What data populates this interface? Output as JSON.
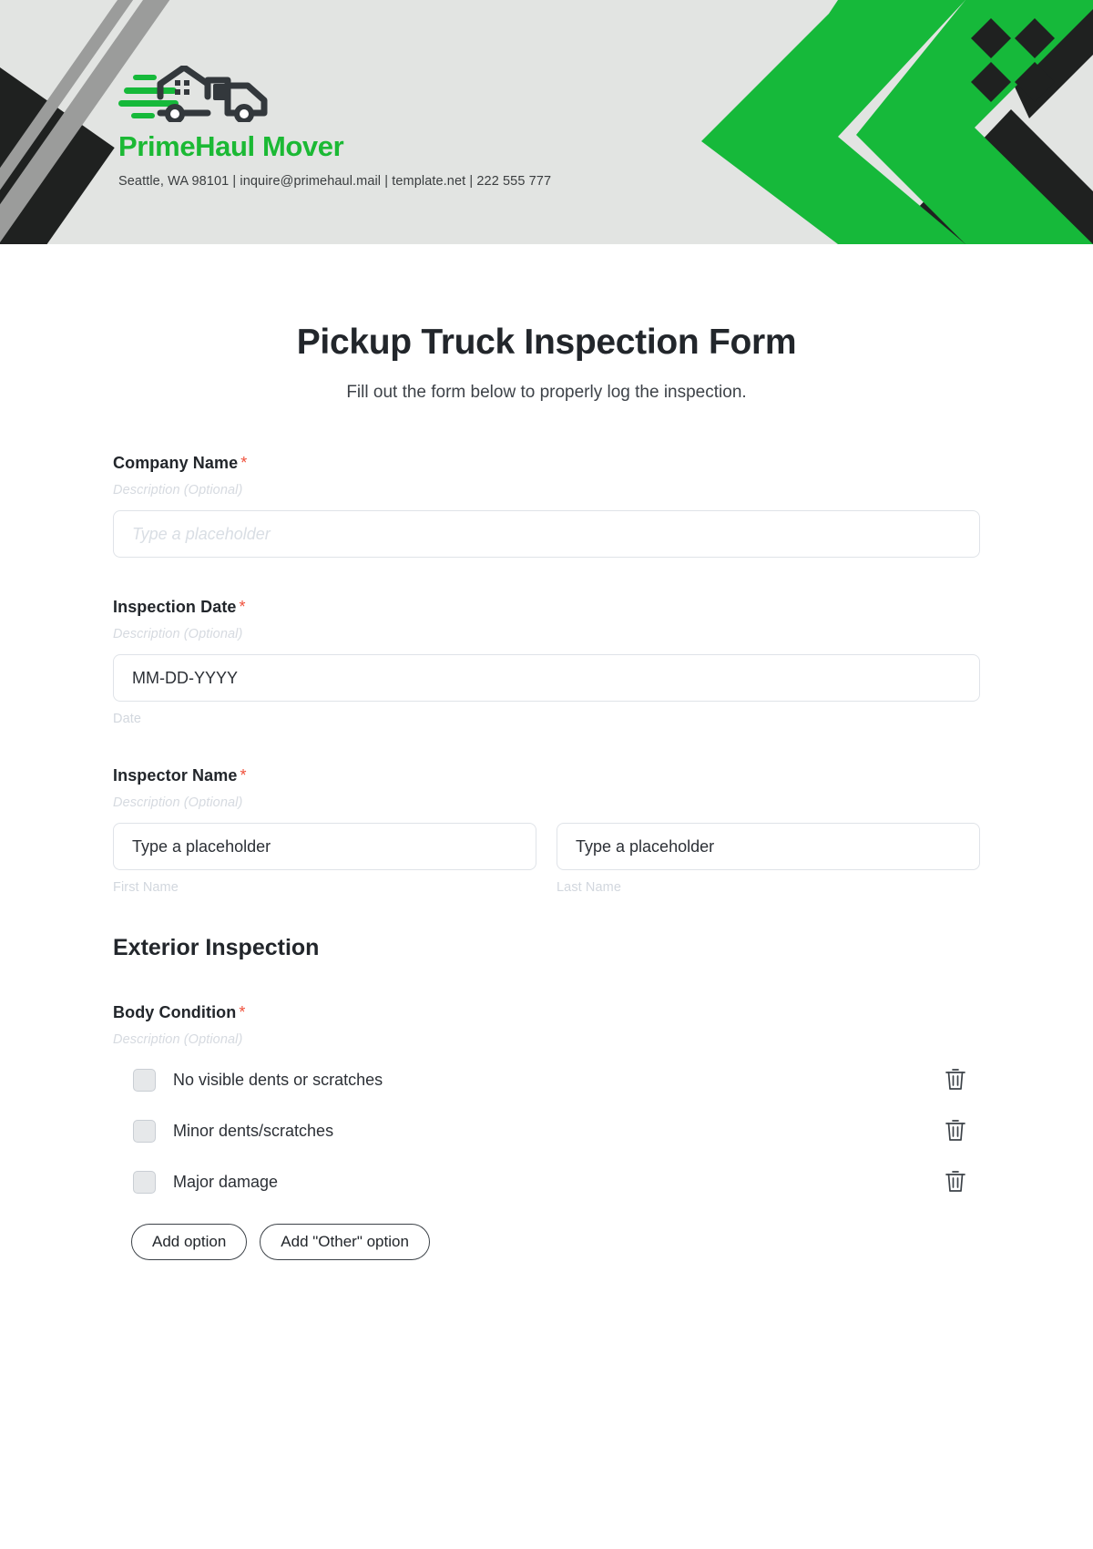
{
  "brand": {
    "name": "PrimeHaul Mover",
    "contact": "Seattle, WA 98101 | inquire@primehaul.mail | template.net | 222 555 777",
    "green": "#1bb934",
    "dark": "#1f2120",
    "banner_bg": "#e2e4e2"
  },
  "header": {
    "title": "Pickup Truck Inspection Form",
    "subtitle": "Fill out the form below to properly log the inspection."
  },
  "common": {
    "description_placeholder": "Description (Optional)",
    "required_marker": "*",
    "type_placeholder": "Type a placeholder"
  },
  "fields": {
    "company_name": {
      "label": "Company Name",
      "description": "Description (Optional)",
      "placeholder": "Type a placeholder",
      "required": true
    },
    "inspection_date": {
      "label": "Inspection Date",
      "description": "Description (Optional)",
      "value": "MM-DD-YYYY",
      "sub_label": "Date",
      "required": true
    },
    "inspector_name": {
      "label": "Inspector Name",
      "description": "Description (Optional)",
      "required": true,
      "first": {
        "placeholder": "Type a placeholder",
        "sub_label": "First Name"
      },
      "last": {
        "placeholder": "Type a placeholder",
        "sub_label": "Last Name"
      }
    }
  },
  "sections": [
    {
      "heading": "Exterior Inspection",
      "question": {
        "label": "Body Condition",
        "description": "Description (Optional)",
        "required": true,
        "options": [
          {
            "label": "No visible dents or scratches"
          },
          {
            "label": "Minor dents/scratches"
          },
          {
            "label": "Major damage"
          }
        ],
        "buttons": {
          "add_option": "Add option",
          "add_other_option": "Add \"Other\" option"
        }
      }
    }
  ]
}
